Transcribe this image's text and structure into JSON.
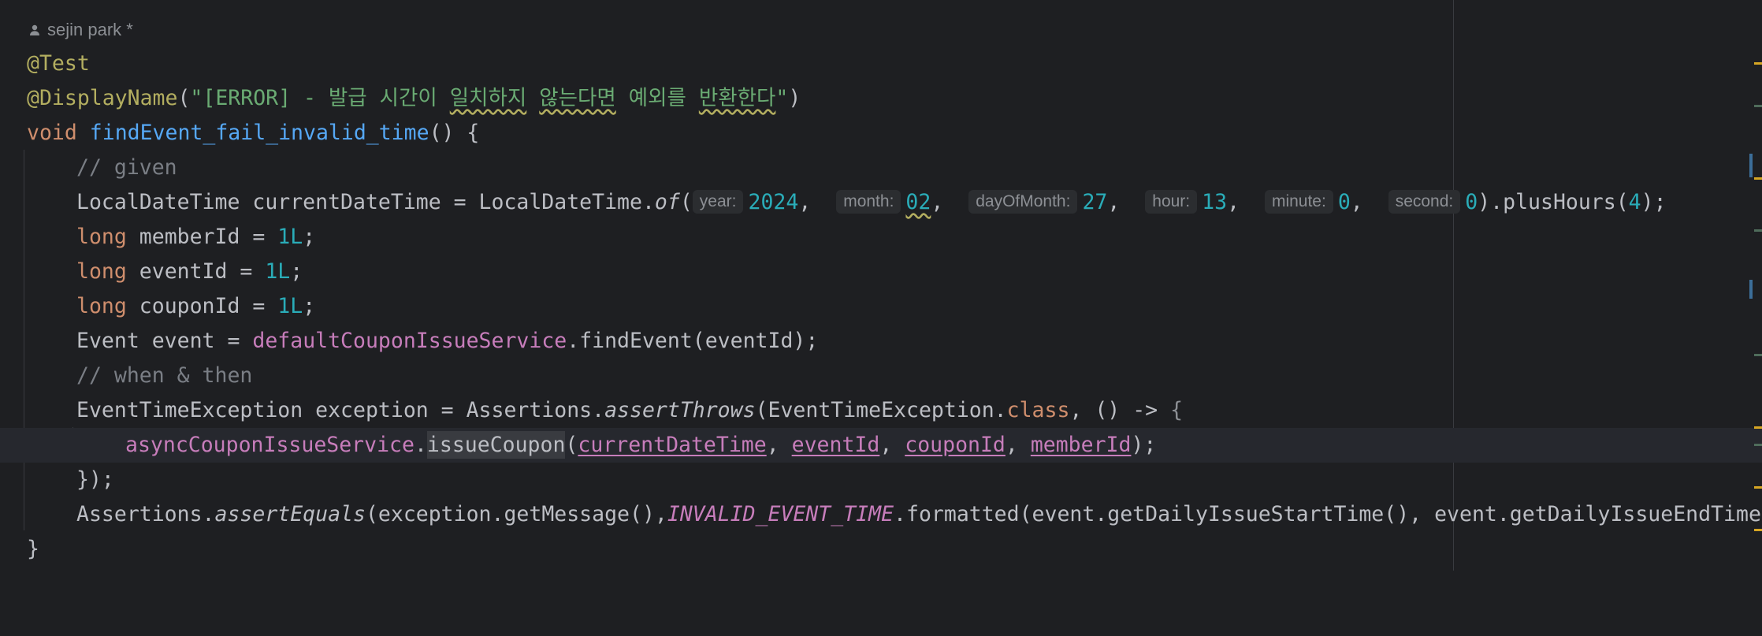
{
  "author": {
    "name": "sejin park *",
    "icon": "person-icon"
  },
  "code": {
    "l1": "@Test",
    "l2_ann": "@DisplayName",
    "l2_open": "(",
    "l2_str": "\"[ERROR] - 발급 시간이 ",
    "l2_squig1": "일치하지",
    "l2_sp1": " ",
    "l2_squig2": "않는다면",
    "l2_sp2": " 예외를 ",
    "l2_squig3": "반환한다",
    "l2_q": "\"",
    "l2_close": ")",
    "l3_kw": "void ",
    "l3_fn": "findEvent_fail_invalid_time",
    "l3_rest": "() {",
    "l4": "// given",
    "l5_a": "LocalDateTime currentDateTime = LocalDateTime.",
    "l5_of": "of",
    "l5_p": "(",
    "hint_year": "year:",
    "v_year": "2024",
    "comma": ",",
    "hint_month": "month:",
    "v_month": "02",
    "hint_day": "dayOfMonth:",
    "v_day": "27",
    "hint_hour": "hour:",
    "v_hour": "13",
    "hint_minute": "minute:",
    "v_minute": "0",
    "hint_second": "second:",
    "v_second": "0",
    "l5_plus": ").plusHours(",
    "v_plus": "4",
    "l5_end": ");",
    "kw_long": "long ",
    "l6_a": "memberId = ",
    "l7_a": "eventId = ",
    "l8_a": "couponId = ",
    "v_1L": "1L",
    "semi": ";",
    "l9_a": "Event event = ",
    "l9_f": "defaultCouponIssueService",
    "l9_b": ".findEvent(eventId);",
    "l10": "// when & then",
    "l11_a": "EventTimeException exception = Assertions.",
    "l11_m": "assertThrows",
    "l11_b": "(EventTimeException.",
    "l11_class": "class",
    "l11_c": ", () -> ",
    "l11_brace": "{",
    "l12_f": "asyncCouponIssueService",
    "dot": ".",
    "l12_m": "issueCoupon",
    "l12_p": "(",
    "l12_a1": "currentDateTime",
    "l12_a2": "eventId",
    "l12_a3": "couponId",
    "l12_a4": "memberId",
    "sep": ", ",
    "l12_end": ");",
    "l13": "});",
    "l14_a": "Assertions.",
    "l14_m": "assertEquals",
    "l14_b": "(exception.getMessage(),",
    "l14_c": "INVALID_EVENT_TIME",
    "l14_d": ".formatted(event.getDailyIssueStartTime(), event.getDailyIssueEndTime())",
    "l15": "}"
  },
  "colors": {
    "background": "#1e1f22",
    "keyword": "#cf8e6d",
    "annotation": "#b3ae60",
    "string": "#6aab73",
    "number": "#2aacb8",
    "function": "#56a8f5",
    "field": "#c77dbb",
    "comment": "#7a7e85"
  }
}
